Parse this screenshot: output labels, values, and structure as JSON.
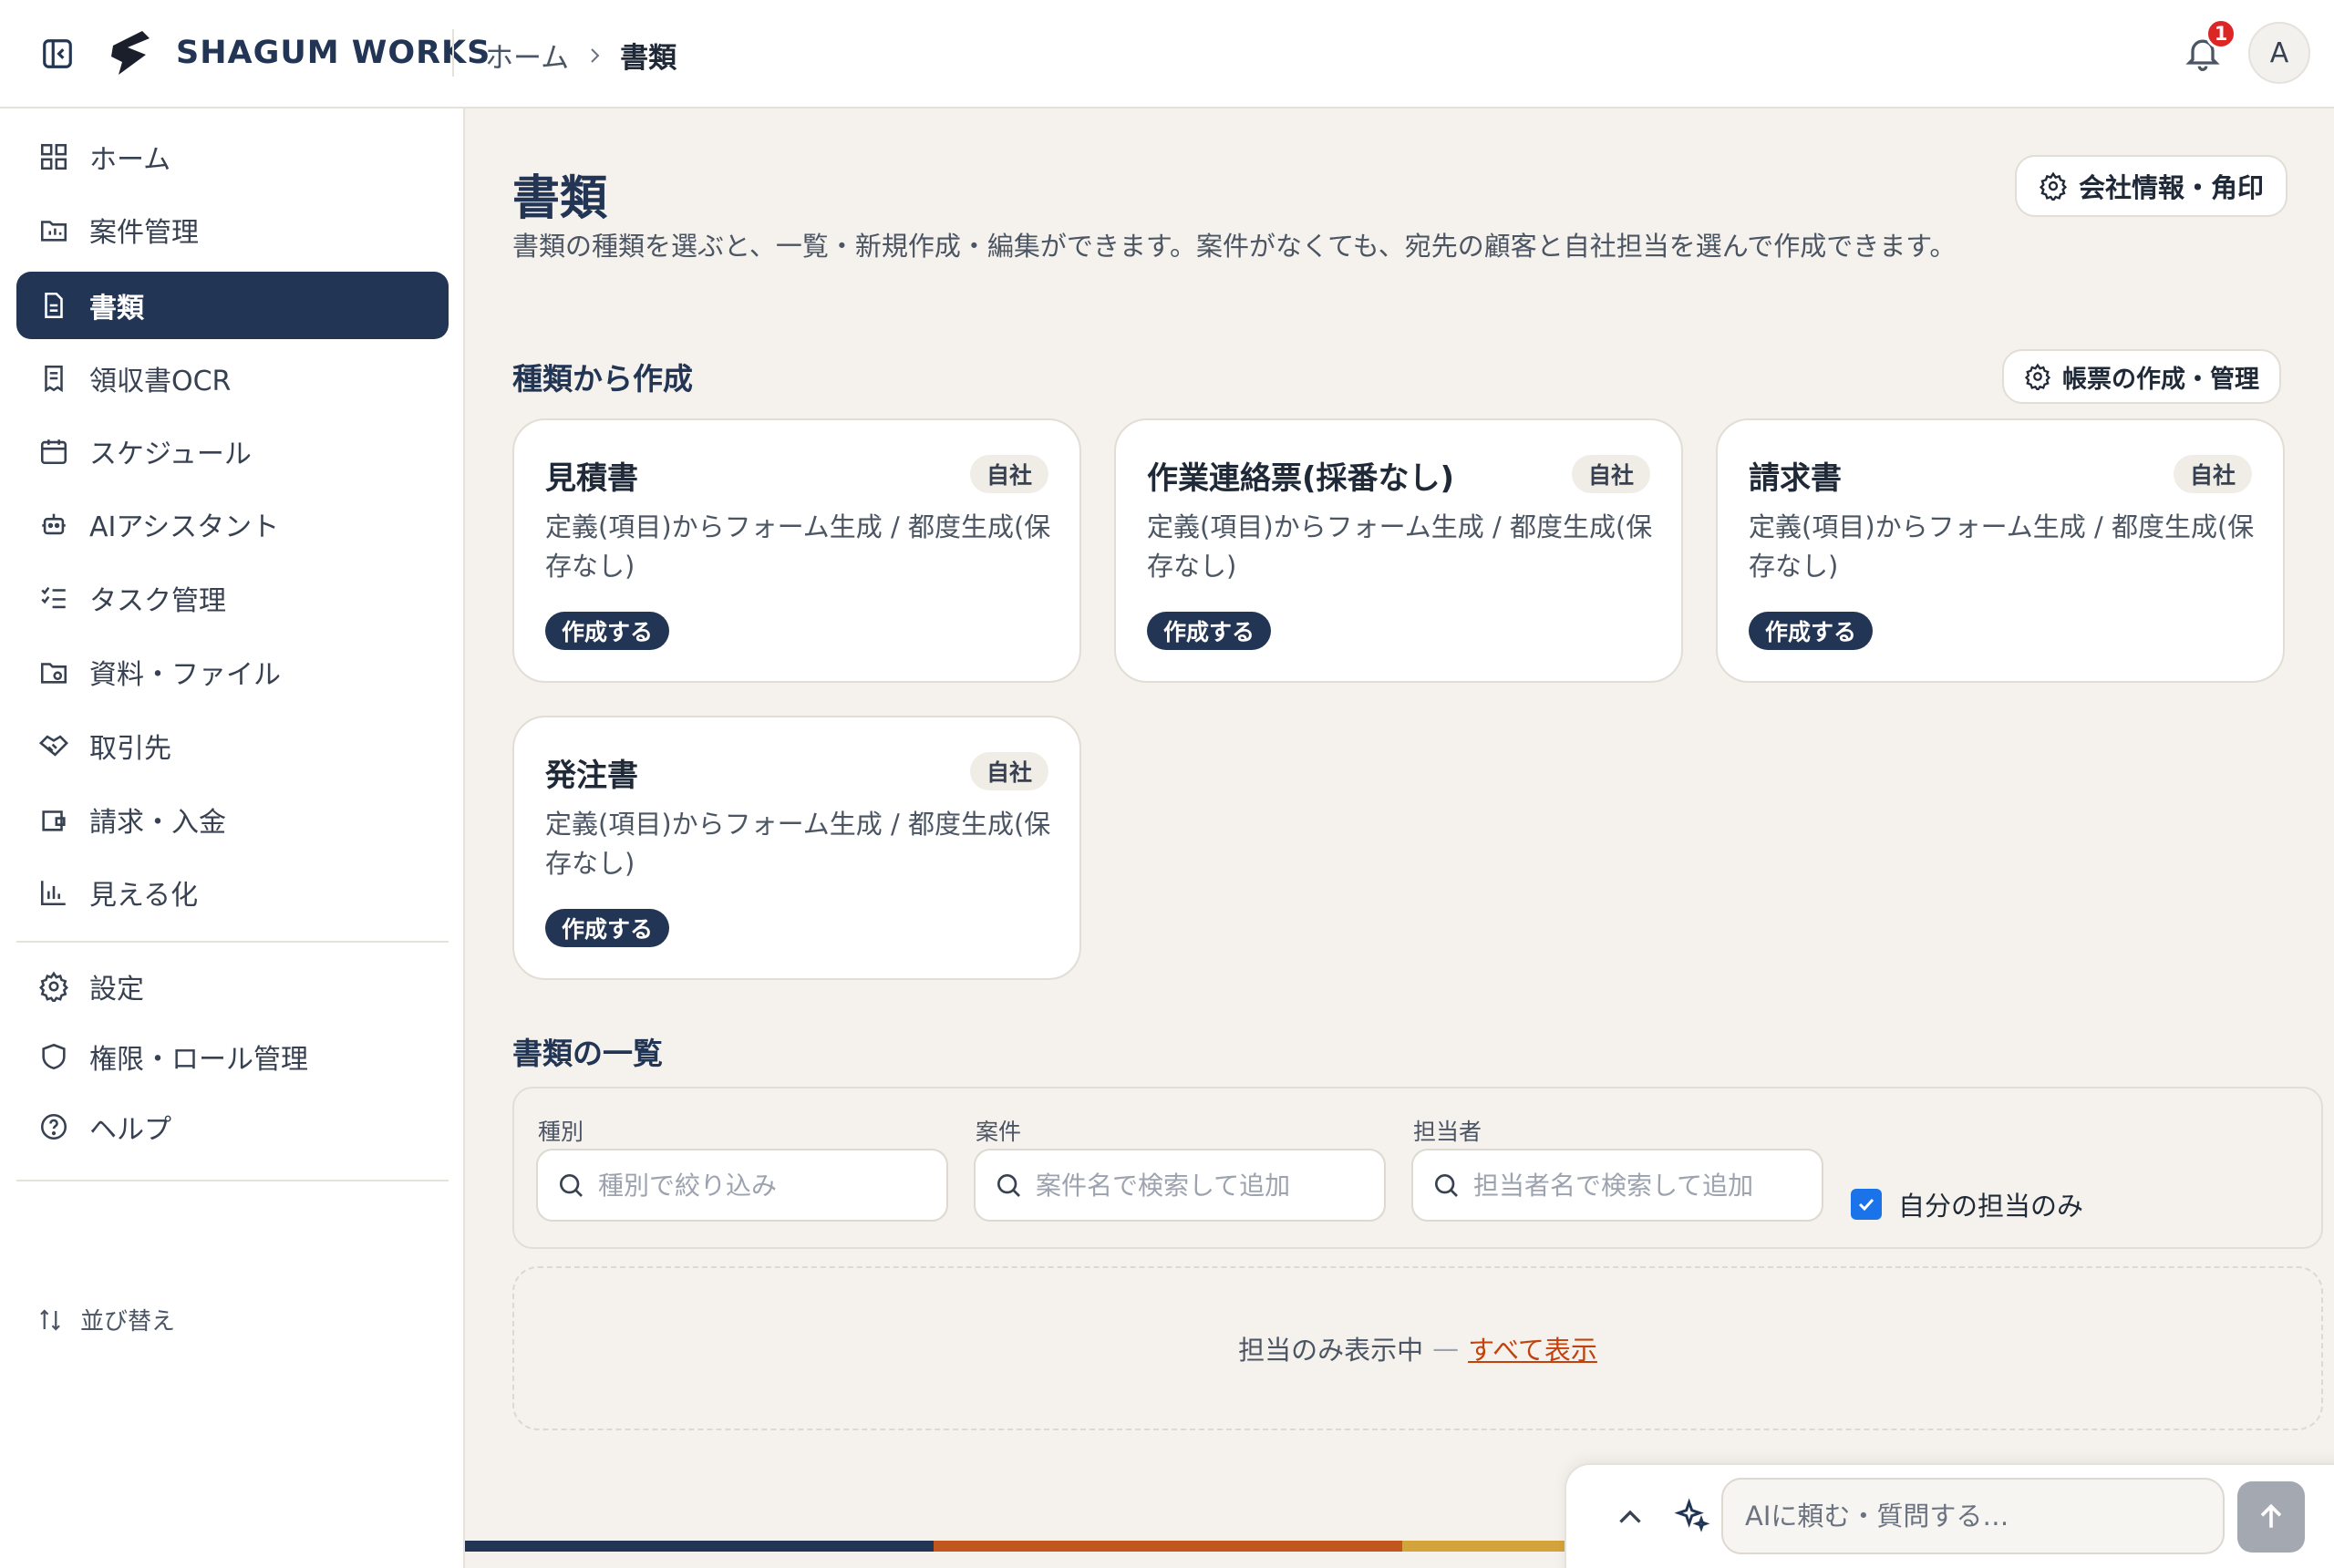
{
  "app": {
    "brand": "SHAGUM WORKS"
  },
  "breadcrumb": {
    "home": "ホーム",
    "current": "書類"
  },
  "notifications": {
    "count": "1"
  },
  "user": {
    "initial": "A"
  },
  "sidebar": {
    "items": [
      {
        "label": "ホーム",
        "icon": "grid-icon"
      },
      {
        "label": "案件管理",
        "icon": "folder-chart-icon"
      },
      {
        "label": "書類",
        "icon": "document-icon",
        "active": true
      },
      {
        "label": "領収書OCR",
        "icon": "receipt-icon"
      },
      {
        "label": "スケジュール",
        "icon": "calendar-icon"
      },
      {
        "label": "AIアシスタント",
        "icon": "robot-icon"
      },
      {
        "label": "タスク管理",
        "icon": "checklist-icon"
      },
      {
        "label": "資料・ファイル",
        "icon": "folder-file-icon"
      },
      {
        "label": "取引先",
        "icon": "handshake-icon"
      },
      {
        "label": "請求・入金",
        "icon": "wallet-icon"
      },
      {
        "label": "見える化",
        "icon": "bar-chart-icon"
      }
    ],
    "secondary": [
      {
        "label": "設定",
        "icon": "gear-icon"
      },
      {
        "label": "権限・ロール管理",
        "icon": "shield-icon"
      },
      {
        "label": "ヘルプ",
        "icon": "help-circle-icon"
      }
    ],
    "sort_label": "並び替え"
  },
  "page": {
    "title": "書類",
    "description": "書類の種類を選ぶと、一覧・新規作成・編集ができます。案件がなくても、宛先の顧客と自社担当を選んで作成できます。",
    "company_button": "会社情報・角印"
  },
  "create_section": {
    "title": "種類から作成",
    "manage_button": "帳票の作成・管理",
    "cards": [
      {
        "title": "見積書",
        "tag": "自社",
        "description": "定義(項目)からフォーム生成 / 都度生成(保存なし)",
        "button": "作成する"
      },
      {
        "title": "作業連絡票(採番なし)",
        "tag": "自社",
        "description": "定義(項目)からフォーム生成 / 都度生成(保存なし)",
        "button": "作成する"
      },
      {
        "title": "請求書",
        "tag": "自社",
        "description": "定義(項目)からフォーム生成 / 都度生成(保存なし)",
        "button": "作成する"
      },
      {
        "title": "発注書",
        "tag": "自社",
        "description": "定義(項目)からフォーム生成 / 都度生成(保存なし)",
        "button": "作成する"
      }
    ]
  },
  "list_section": {
    "title": "書類の一覧",
    "filters": {
      "type": {
        "label": "種別",
        "placeholder": "種別で絞り込み",
        "value": ""
      },
      "project": {
        "label": "案件",
        "placeholder": "案件名で検索して追加",
        "value": ""
      },
      "assignee": {
        "label": "担当者",
        "placeholder": "担当者名で検索して追加",
        "value": ""
      },
      "mine_only": {
        "label": "自分の担当のみ",
        "checked": true
      }
    },
    "empty": {
      "text": "担当のみ表示中",
      "dash": "—",
      "link": "すべて表示"
    }
  },
  "ai": {
    "placeholder": "AIに頼む・質問する…"
  },
  "colors": {
    "navy": "#223554",
    "rust": "#c2561f",
    "gold": "#d4a43c",
    "accent_link": "#c2410c"
  }
}
